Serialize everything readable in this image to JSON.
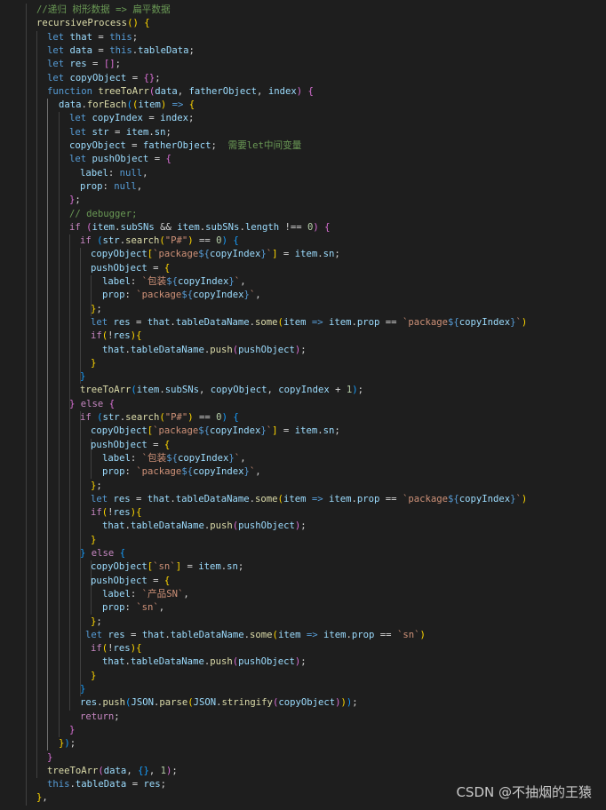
{
  "watermark": "CSDN @不抽烟的王猿",
  "lines": [
    [
      [
        "cmt",
        "//递归 树形数据 => 扁平数据"
      ]
    ],
    [
      [
        "fn",
        "recursiveProcess"
      ],
      [
        "p1",
        "("
      ],
      [
        "p1",
        ")"
      ],
      [
        "pl",
        " "
      ],
      [
        "p1",
        "{"
      ]
    ],
    [
      [
        "kw",
        "let"
      ],
      [
        "pl",
        " "
      ],
      [
        "var",
        "that"
      ],
      [
        "op",
        " = "
      ],
      [
        "kw",
        "this"
      ],
      [
        "pl",
        ";"
      ]
    ],
    [
      [
        "kw",
        "let"
      ],
      [
        "pl",
        " "
      ],
      [
        "var",
        "data"
      ],
      [
        "op",
        " = "
      ],
      [
        "kw",
        "this"
      ],
      [
        "pl",
        "."
      ],
      [
        "var",
        "tableData"
      ],
      [
        "pl",
        ";"
      ]
    ],
    [
      [
        "kw",
        "let"
      ],
      [
        "pl",
        " "
      ],
      [
        "var",
        "res"
      ],
      [
        "op",
        " = "
      ],
      [
        "p2",
        "["
      ],
      [
        "p2",
        "]"
      ],
      [
        "pl",
        ";"
      ]
    ],
    [
      [
        "kw",
        "let"
      ],
      [
        "pl",
        " "
      ],
      [
        "var",
        "copyObject"
      ],
      [
        "op",
        " = "
      ],
      [
        "p2",
        "{"
      ],
      [
        "p2",
        "}"
      ],
      [
        "pl",
        ";"
      ]
    ],
    [
      [
        "kw",
        "function"
      ],
      [
        "pl",
        " "
      ],
      [
        "fn",
        "treeToArr"
      ],
      [
        "p2",
        "("
      ],
      [
        "var",
        "data"
      ],
      [
        "pl",
        ", "
      ],
      [
        "var",
        "fatherObject"
      ],
      [
        "pl",
        ", "
      ],
      [
        "var",
        "index"
      ],
      [
        "p2",
        ")"
      ],
      [
        "pl",
        " "
      ],
      [
        "p2",
        "{"
      ]
    ],
    [
      [
        "var",
        "data"
      ],
      [
        "pl",
        "."
      ],
      [
        "fn",
        "forEach"
      ],
      [
        "p3",
        "("
      ],
      [
        "p1",
        "("
      ],
      [
        "var",
        "item"
      ],
      [
        "p1",
        ")"
      ],
      [
        "pl",
        " "
      ],
      [
        "kw",
        "=>"
      ],
      [
        "pl",
        " "
      ],
      [
        "p1",
        "{"
      ]
    ],
    [
      [
        "kw",
        "let"
      ],
      [
        "pl",
        " "
      ],
      [
        "var",
        "copyIndex"
      ],
      [
        "op",
        " = "
      ],
      [
        "var",
        "index"
      ],
      [
        "pl",
        ";"
      ]
    ],
    [
      [
        "kw",
        "let"
      ],
      [
        "pl",
        " "
      ],
      [
        "var",
        "str"
      ],
      [
        "op",
        " = "
      ],
      [
        "var",
        "item"
      ],
      [
        "pl",
        "."
      ],
      [
        "var",
        "sn"
      ],
      [
        "pl",
        ";"
      ]
    ],
    [
      [
        "var",
        "copyObject"
      ],
      [
        "op",
        " = "
      ],
      [
        "var",
        "fatherObject"
      ],
      [
        "pl",
        ";  "
      ],
      [
        "cmt",
        "需要let中间变量"
      ]
    ],
    [
      [
        "kw",
        "let"
      ],
      [
        "pl",
        " "
      ],
      [
        "var",
        "pushObject"
      ],
      [
        "op",
        " = "
      ],
      [
        "p2",
        "{"
      ]
    ],
    [
      [
        "var",
        "label"
      ],
      [
        "pl",
        ": "
      ],
      [
        "kw",
        "null"
      ],
      [
        "pl",
        ","
      ]
    ],
    [
      [
        "var",
        "prop"
      ],
      [
        "pl",
        ": "
      ],
      [
        "kw",
        "null"
      ],
      [
        "pl",
        ","
      ]
    ],
    [
      [
        "p2",
        "}"
      ],
      [
        "pl",
        ";"
      ]
    ],
    [
      [
        "cmt",
        "// debugger;"
      ]
    ],
    [
      [
        "ctl",
        "if"
      ],
      [
        "pl",
        " "
      ],
      [
        "p2",
        "("
      ],
      [
        "var",
        "item"
      ],
      [
        "pl",
        "."
      ],
      [
        "var",
        "subSNs"
      ],
      [
        "op",
        " && "
      ],
      [
        "var",
        "item"
      ],
      [
        "pl",
        "."
      ],
      [
        "var",
        "subSNs"
      ],
      [
        "pl",
        "."
      ],
      [
        "var",
        "length"
      ],
      [
        "op",
        " !== "
      ],
      [
        "num",
        "0"
      ],
      [
        "p2",
        ")"
      ],
      [
        "pl",
        " "
      ],
      [
        "p2",
        "{"
      ]
    ],
    [
      [
        "ctl",
        "if"
      ],
      [
        "pl",
        " "
      ],
      [
        "p3",
        "("
      ],
      [
        "var",
        "str"
      ],
      [
        "pl",
        "."
      ],
      [
        "fn",
        "search"
      ],
      [
        "p1",
        "("
      ],
      [
        "str",
        "\"P#\""
      ],
      [
        "p1",
        ")"
      ],
      [
        "op",
        " == "
      ],
      [
        "num",
        "0"
      ],
      [
        "p3",
        ")"
      ],
      [
        "pl",
        " "
      ],
      [
        "p3",
        "{"
      ]
    ],
    [
      [
        "var",
        "copyObject"
      ],
      [
        "p1",
        "["
      ],
      [
        "str",
        "`package"
      ],
      [
        "kw",
        "${"
      ],
      [
        "var",
        "copyIndex"
      ],
      [
        "kw",
        "}"
      ],
      [
        "str",
        "`"
      ],
      [
        "p1",
        "]"
      ],
      [
        "op",
        " = "
      ],
      [
        "var",
        "item"
      ],
      [
        "pl",
        "."
      ],
      [
        "var",
        "sn"
      ],
      [
        "pl",
        ";"
      ]
    ],
    [
      [
        "var",
        "pushObject"
      ],
      [
        "op",
        " = "
      ],
      [
        "p1",
        "{"
      ]
    ],
    [
      [
        "var",
        "label"
      ],
      [
        "pl",
        ": "
      ],
      [
        "str",
        "`包装"
      ],
      [
        "kw",
        "${"
      ],
      [
        "var",
        "copyIndex"
      ],
      [
        "kw",
        "}"
      ],
      [
        "str",
        "`"
      ],
      [
        "pl",
        ","
      ]
    ],
    [
      [
        "var",
        "prop"
      ],
      [
        "pl",
        ": "
      ],
      [
        "str",
        "`package"
      ],
      [
        "kw",
        "${"
      ],
      [
        "var",
        "copyIndex"
      ],
      [
        "kw",
        "}"
      ],
      [
        "str",
        "`"
      ],
      [
        "pl",
        ","
      ]
    ],
    [
      [
        "p1",
        "}"
      ],
      [
        "pl",
        ";"
      ]
    ],
    [
      [
        "kw",
        "let"
      ],
      [
        "pl",
        " "
      ],
      [
        "var",
        "res"
      ],
      [
        "op",
        " = "
      ],
      [
        "var",
        "that"
      ],
      [
        "pl",
        "."
      ],
      [
        "var",
        "tableDataName"
      ],
      [
        "pl",
        "."
      ],
      [
        "fn",
        "some"
      ],
      [
        "p1",
        "("
      ],
      [
        "var",
        "item"
      ],
      [
        "pl",
        " "
      ],
      [
        "kw",
        "=>"
      ],
      [
        "pl",
        " "
      ],
      [
        "var",
        "item"
      ],
      [
        "pl",
        "."
      ],
      [
        "var",
        "prop"
      ],
      [
        "op",
        " == "
      ],
      [
        "str",
        "`package"
      ],
      [
        "kw",
        "${"
      ],
      [
        "var",
        "copyIndex"
      ],
      [
        "kw",
        "}"
      ],
      [
        "str",
        "`"
      ],
      [
        "p1",
        ")"
      ]
    ],
    [
      [
        "ctl",
        "if"
      ],
      [
        "p1",
        "("
      ],
      [
        "op",
        "!"
      ],
      [
        "var",
        "res"
      ],
      [
        "p1",
        ")"
      ],
      [
        "p1",
        "{"
      ]
    ],
    [
      [
        "var",
        "that"
      ],
      [
        "pl",
        "."
      ],
      [
        "var",
        "tableDataName"
      ],
      [
        "pl",
        "."
      ],
      [
        "fn",
        "push"
      ],
      [
        "p2",
        "("
      ],
      [
        "var",
        "pushObject"
      ],
      [
        "p2",
        ")"
      ],
      [
        "pl",
        ";"
      ]
    ],
    [
      [
        "p1",
        "}"
      ]
    ],
    [
      [
        "p3",
        "}"
      ]
    ],
    [
      [
        "fn",
        "treeToArr"
      ],
      [
        "p3",
        "("
      ],
      [
        "var",
        "item"
      ],
      [
        "pl",
        "."
      ],
      [
        "var",
        "subSNs"
      ],
      [
        "pl",
        ", "
      ],
      [
        "var",
        "copyObject"
      ],
      [
        "pl",
        ", "
      ],
      [
        "var",
        "copyIndex"
      ],
      [
        "op",
        " + "
      ],
      [
        "num",
        "1"
      ],
      [
        "p3",
        ")"
      ],
      [
        "pl",
        ";"
      ]
    ],
    [
      [
        "p2",
        "}"
      ],
      [
        "pl",
        " "
      ],
      [
        "ctl",
        "else"
      ],
      [
        "pl",
        " "
      ],
      [
        "p2",
        "{"
      ]
    ],
    [
      [
        "ctl",
        "if"
      ],
      [
        "pl",
        " "
      ],
      [
        "p3",
        "("
      ],
      [
        "var",
        "str"
      ],
      [
        "pl",
        "."
      ],
      [
        "fn",
        "search"
      ],
      [
        "p1",
        "("
      ],
      [
        "str",
        "\"P#\""
      ],
      [
        "p1",
        ")"
      ],
      [
        "op",
        " == "
      ],
      [
        "num",
        "0"
      ],
      [
        "p3",
        ")"
      ],
      [
        "pl",
        " "
      ],
      [
        "p3",
        "{"
      ]
    ],
    [
      [
        "var",
        "copyObject"
      ],
      [
        "p1",
        "["
      ],
      [
        "str",
        "`package"
      ],
      [
        "kw",
        "${"
      ],
      [
        "var",
        "copyIndex"
      ],
      [
        "kw",
        "}"
      ],
      [
        "str",
        "`"
      ],
      [
        "p1",
        "]"
      ],
      [
        "op",
        " = "
      ],
      [
        "var",
        "item"
      ],
      [
        "pl",
        "."
      ],
      [
        "var",
        "sn"
      ],
      [
        "pl",
        ";"
      ]
    ],
    [
      [
        "var",
        "pushObject"
      ],
      [
        "op",
        " = "
      ],
      [
        "p1",
        "{"
      ]
    ],
    [
      [
        "var",
        "label"
      ],
      [
        "pl",
        ": "
      ],
      [
        "str",
        "`包装"
      ],
      [
        "kw",
        "${"
      ],
      [
        "var",
        "copyIndex"
      ],
      [
        "kw",
        "}"
      ],
      [
        "str",
        "`"
      ],
      [
        "pl",
        ","
      ]
    ],
    [
      [
        "var",
        "prop"
      ],
      [
        "pl",
        ": "
      ],
      [
        "str",
        "`package"
      ],
      [
        "kw",
        "${"
      ],
      [
        "var",
        "copyIndex"
      ],
      [
        "kw",
        "}"
      ],
      [
        "str",
        "`"
      ],
      [
        "pl",
        ","
      ]
    ],
    [
      [
        "p1",
        "}"
      ],
      [
        "pl",
        ";"
      ]
    ],
    [
      [
        "kw",
        "let"
      ],
      [
        "pl",
        " "
      ],
      [
        "var",
        "res"
      ],
      [
        "op",
        " = "
      ],
      [
        "var",
        "that"
      ],
      [
        "pl",
        "."
      ],
      [
        "var",
        "tableDataName"
      ],
      [
        "pl",
        "."
      ],
      [
        "fn",
        "some"
      ],
      [
        "p1",
        "("
      ],
      [
        "var",
        "item"
      ],
      [
        "pl",
        " "
      ],
      [
        "kw",
        "=>"
      ],
      [
        "pl",
        " "
      ],
      [
        "var",
        "item"
      ],
      [
        "pl",
        "."
      ],
      [
        "var",
        "prop"
      ],
      [
        "op",
        " == "
      ],
      [
        "str",
        "`package"
      ],
      [
        "kw",
        "${"
      ],
      [
        "var",
        "copyIndex"
      ],
      [
        "kw",
        "}"
      ],
      [
        "str",
        "`"
      ],
      [
        "p1",
        ")"
      ]
    ],
    [
      [
        "ctl",
        "if"
      ],
      [
        "p1",
        "("
      ],
      [
        "op",
        "!"
      ],
      [
        "var",
        "res"
      ],
      [
        "p1",
        ")"
      ],
      [
        "p1",
        "{"
      ]
    ],
    [
      [
        "var",
        "that"
      ],
      [
        "pl",
        "."
      ],
      [
        "var",
        "tableDataName"
      ],
      [
        "pl",
        "."
      ],
      [
        "fn",
        "push"
      ],
      [
        "p2",
        "("
      ],
      [
        "var",
        "pushObject"
      ],
      [
        "p2",
        ")"
      ],
      [
        "pl",
        ";"
      ]
    ],
    [
      [
        "p1",
        "}"
      ]
    ],
    [
      [
        "p3",
        "}"
      ],
      [
        "pl",
        " "
      ],
      [
        "ctl",
        "else"
      ],
      [
        "pl",
        " "
      ],
      [
        "p3",
        "{"
      ]
    ],
    [
      [
        "var",
        "copyObject"
      ],
      [
        "p1",
        "["
      ],
      [
        "str",
        "`sn`"
      ],
      [
        "p1",
        "]"
      ],
      [
        "op",
        " = "
      ],
      [
        "var",
        "item"
      ],
      [
        "pl",
        "."
      ],
      [
        "var",
        "sn"
      ],
      [
        "pl",
        ";"
      ]
    ],
    [
      [
        "var",
        "pushObject"
      ],
      [
        "op",
        " = "
      ],
      [
        "p1",
        "{"
      ]
    ],
    [
      [
        "var",
        "label"
      ],
      [
        "pl",
        ": "
      ],
      [
        "str",
        "`产品SN`"
      ],
      [
        "pl",
        ","
      ]
    ],
    [
      [
        "var",
        "prop"
      ],
      [
        "pl",
        ": "
      ],
      [
        "str",
        "`sn`"
      ],
      [
        "pl",
        ","
      ]
    ],
    [
      [
        "p1",
        "}"
      ],
      [
        "pl",
        ";"
      ]
    ],
    [
      [
        "kw",
        "let"
      ],
      [
        "pl",
        " "
      ],
      [
        "var",
        "res"
      ],
      [
        "op",
        " = "
      ],
      [
        "var",
        "that"
      ],
      [
        "pl",
        "."
      ],
      [
        "var",
        "tableDataName"
      ],
      [
        "pl",
        "."
      ],
      [
        "fn",
        "some"
      ],
      [
        "p1",
        "("
      ],
      [
        "var",
        "item"
      ],
      [
        "pl",
        " "
      ],
      [
        "kw",
        "=>"
      ],
      [
        "pl",
        " "
      ],
      [
        "var",
        "item"
      ],
      [
        "pl",
        "."
      ],
      [
        "var",
        "prop"
      ],
      [
        "op",
        " == "
      ],
      [
        "str",
        "`sn`"
      ],
      [
        "p1",
        ")"
      ]
    ],
    [
      [
        "ctl",
        "if"
      ],
      [
        "p1",
        "("
      ],
      [
        "op",
        "!"
      ],
      [
        "var",
        "res"
      ],
      [
        "p1",
        ")"
      ],
      [
        "p1",
        "{"
      ]
    ],
    [
      [
        "var",
        "that"
      ],
      [
        "pl",
        "."
      ],
      [
        "var",
        "tableDataName"
      ],
      [
        "pl",
        "."
      ],
      [
        "fn",
        "push"
      ],
      [
        "p2",
        "("
      ],
      [
        "var",
        "pushObject"
      ],
      [
        "p2",
        ")"
      ],
      [
        "pl",
        ";"
      ]
    ],
    [
      [
        "p1",
        "}"
      ]
    ],
    [
      [
        "p3",
        "}"
      ]
    ],
    [
      [
        "var",
        "res"
      ],
      [
        "pl",
        "."
      ],
      [
        "fn",
        "push"
      ],
      [
        "p3",
        "("
      ],
      [
        "var",
        "JSON"
      ],
      [
        "pl",
        "."
      ],
      [
        "fn",
        "parse"
      ],
      [
        "p1",
        "("
      ],
      [
        "var",
        "JSON"
      ],
      [
        "pl",
        "."
      ],
      [
        "fn",
        "stringify"
      ],
      [
        "p2",
        "("
      ],
      [
        "var",
        "copyObject"
      ],
      [
        "p2",
        ")"
      ],
      [
        "p1",
        ")"
      ],
      [
        "p3",
        ")"
      ],
      [
        "pl",
        ";"
      ]
    ],
    [
      [
        "ctl",
        "return"
      ],
      [
        "pl",
        ";"
      ]
    ],
    [
      [
        "p2",
        "}"
      ]
    ],
    [
      [
        "p1",
        "}"
      ],
      [
        "p3",
        ")"
      ],
      [
        "pl",
        ";"
      ]
    ],
    [
      [
        "p2",
        "}"
      ]
    ],
    [
      [
        "fn",
        "treeToArr"
      ],
      [
        "p2",
        "("
      ],
      [
        "var",
        "data"
      ],
      [
        "pl",
        ", "
      ],
      [
        "p3",
        "{"
      ],
      [
        "p3",
        "}"
      ],
      [
        "pl",
        ", "
      ],
      [
        "num",
        "1"
      ],
      [
        "p2",
        ")"
      ],
      [
        "pl",
        ";"
      ]
    ],
    [
      [
        "kw",
        "this"
      ],
      [
        "pl",
        "."
      ],
      [
        "var",
        "tableData"
      ],
      [
        "op",
        " = "
      ],
      [
        "var",
        "res"
      ],
      [
        "pl",
        ";"
      ]
    ],
    [
      [
        "p1",
        "}"
      ],
      [
        "pl",
        ","
      ]
    ]
  ]
}
